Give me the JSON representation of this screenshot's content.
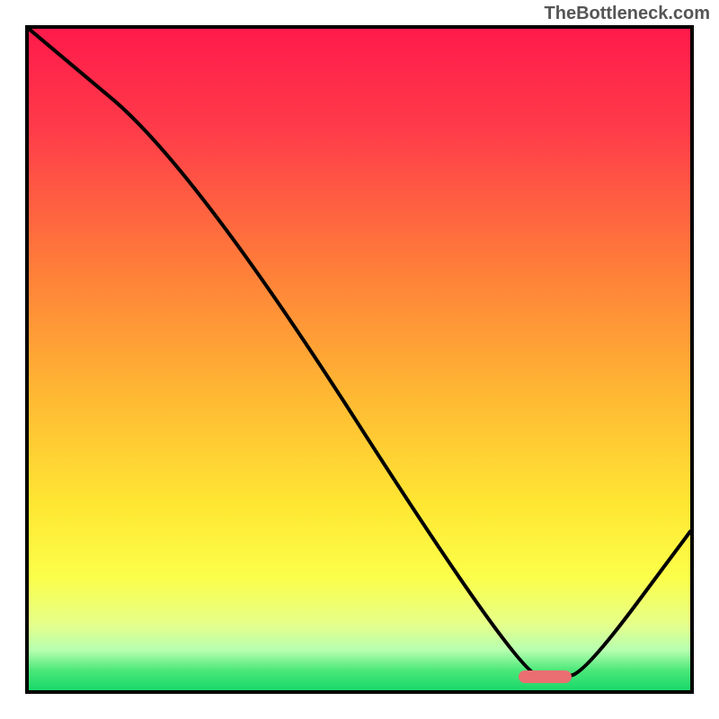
{
  "watermark": "TheBottleneck.com",
  "chart_data": {
    "type": "line",
    "title": "",
    "xlabel": "",
    "ylabel": "",
    "xlim": [
      0,
      100
    ],
    "ylim": [
      0,
      100
    ],
    "series": [
      {
        "name": "curve",
        "x": [
          0,
          25,
          74,
          80,
          84,
          100
        ],
        "y": [
          100,
          79,
          2.5,
          2.0,
          2.5,
          24
        ]
      }
    ],
    "annotations": [
      {
        "name": "optimal-marker",
        "x_range": [
          74,
          82
        ],
        "y": 2
      }
    ],
    "gradient_stops": [
      {
        "pos": 0.0,
        "color": "#ff1a4b"
      },
      {
        "pos": 0.15,
        "color": "#ff3b4a"
      },
      {
        "pos": 0.35,
        "color": "#ff7a3a"
      },
      {
        "pos": 0.55,
        "color": "#ffb733"
      },
      {
        "pos": 0.72,
        "color": "#ffe733"
      },
      {
        "pos": 0.83,
        "color": "#fbff4a"
      },
      {
        "pos": 0.9,
        "color": "#e6ff8a"
      },
      {
        "pos": 0.94,
        "color": "#b6ffb0"
      },
      {
        "pos": 0.97,
        "color": "#4be879"
      },
      {
        "pos": 1.0,
        "color": "#19d86a"
      }
    ]
  }
}
